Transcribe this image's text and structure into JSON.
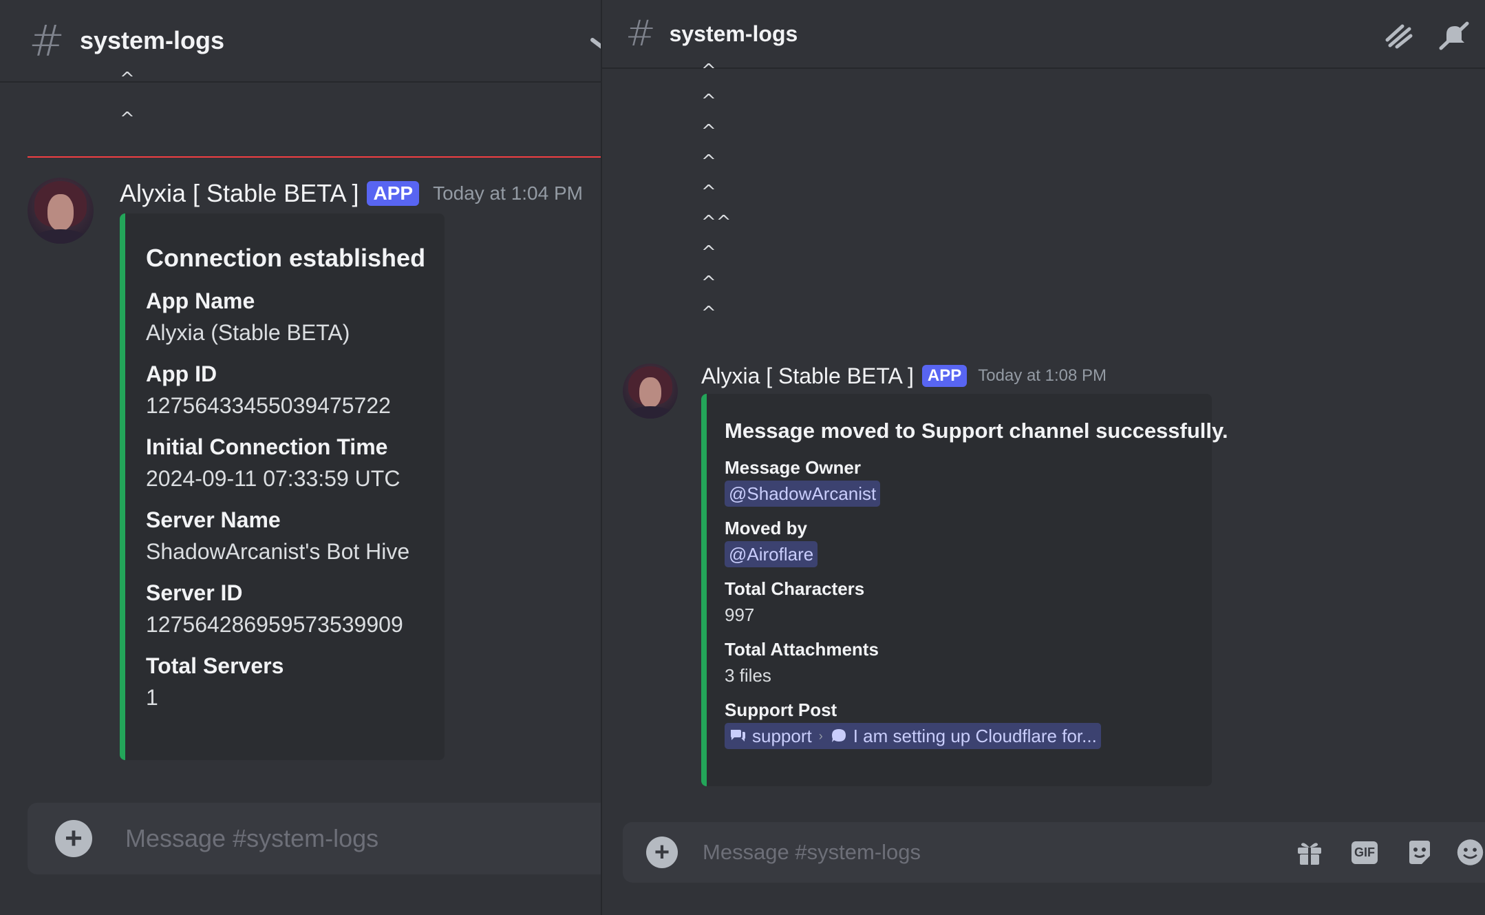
{
  "left": {
    "channel_name": "system-logs",
    "carets": [
      "^",
      "^"
    ],
    "message": {
      "author": "Alyxia [ Stable BETA ]",
      "badge": "APP",
      "timestamp": "Today at 1:04 PM",
      "embed": {
        "title": "Connection established",
        "fields": [
          {
            "name": "App Name",
            "value": "Alyxia (Stable BETA)"
          },
          {
            "name": "App ID",
            "value": "1275643345503947572​2"
          },
          {
            "name": "Initial Connection Time",
            "value": "2024-09-11 07:33:59 UTC"
          },
          {
            "name": "Server Name",
            "value": "ShadowArcanist's Bot Hive"
          },
          {
            "name": "Server ID",
            "value": "1275642869595735399​09"
          },
          {
            "name": "Total Servers",
            "value": "1"
          }
        ]
      }
    },
    "composer_placeholder": "Message #system-logs"
  },
  "right": {
    "channel_name": "system-logs",
    "carets": [
      "^",
      "^",
      "^",
      "^",
      "^",
      "^^",
      "^",
      "^",
      "^"
    ],
    "message": {
      "author": "Alyxia [ Stable BETA ]",
      "badge": "APP",
      "timestamp": "Today at 1:08 PM",
      "embed": {
        "title": "Message moved to Support channel successfully.",
        "owner_label": "Message Owner",
        "owner_value": "@ShadowArcanist",
        "moved_label": "Moved by",
        "moved_value": "@Airoflare",
        "chars_label": "Total Characters",
        "chars_value": "997",
        "attach_label": "Total Attachments",
        "attach_value": "3 files",
        "post_label": "Support Post",
        "post_channel": "support",
        "post_thread": "I am setting up Cloudflare for..."
      }
    },
    "composer_placeholder": "Message #system-logs",
    "gif_label": "GIF"
  },
  "colors": {
    "background": "#313338",
    "embed_bar": "#23a559",
    "app_badge": "#5865f2",
    "new_message_line": "#f23f42",
    "mention_bg": "#3c4270"
  },
  "icons": [
    "hash-icon",
    "threads-icon",
    "mute-icon",
    "plus-icon",
    "gift-icon",
    "gif-icon",
    "sticker-icon",
    "emoji-icon",
    "forum-icon",
    "thread-icon"
  ]
}
